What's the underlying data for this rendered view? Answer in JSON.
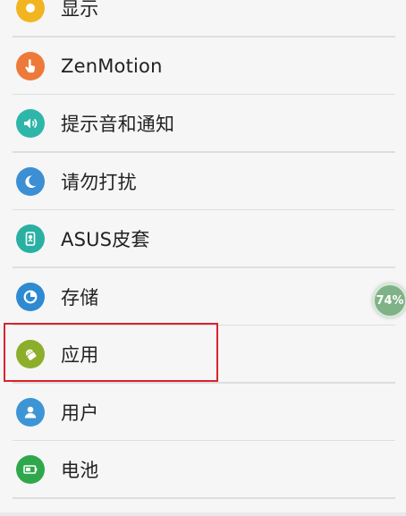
{
  "settings": {
    "items": [
      {
        "label": "显示",
        "icon": "display-icon",
        "color": "#f2b522"
      },
      {
        "label": "ZenMotion",
        "icon": "hand-touch-icon",
        "color": "#ee7a39"
      },
      {
        "label": "提示音和通知",
        "icon": "speaker-icon",
        "color": "#2eb6a9"
      },
      {
        "label": "请勿打扰",
        "icon": "moon-icon",
        "color": "#3c8fd2"
      },
      {
        "label": "ASUS皮套",
        "icon": "phone-cover-icon",
        "color": "#29b0a3"
      },
      {
        "label": "存储",
        "icon": "storage-icon",
        "color": "#2e8ad1"
      },
      {
        "label": "应用",
        "icon": "android-icon",
        "color": "#8dae2b"
      },
      {
        "label": "用户",
        "icon": "user-icon",
        "color": "#3d95d6"
      },
      {
        "label": "电池",
        "icon": "battery-icon",
        "color": "#2ea84b"
      }
    ],
    "highlighted_item": "应用"
  },
  "floating_widget": {
    "text": "74%",
    "color": "#7fb287"
  }
}
